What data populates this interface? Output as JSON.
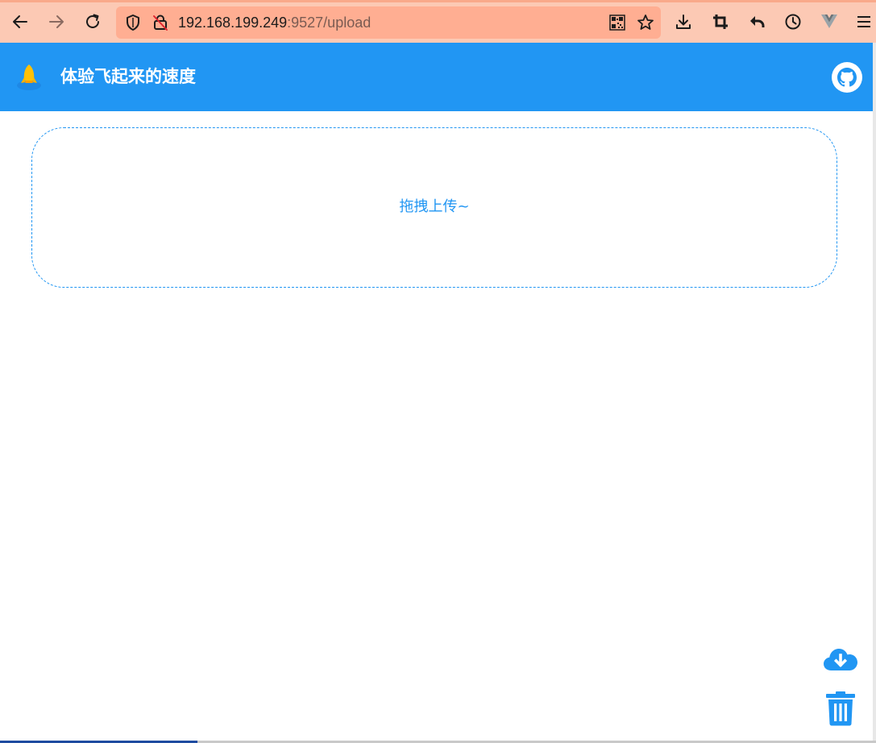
{
  "browser": {
    "url_host": "192.168.199.249",
    "url_rest": ":9527/upload",
    "icons": {
      "back": "arrow-left-icon",
      "forward": "arrow-right-icon",
      "reload": "reload-icon",
      "tracking": "shield-icon",
      "insecure": "lock-insecure-icon",
      "qr": "qr-code-icon",
      "bookmark": "star-icon",
      "downloads": "download-icon",
      "screenshot": "crop-icon",
      "undo": "undo-icon",
      "history": "clock-icon",
      "extension": "vue-devtools-icon",
      "menu": "hamburger-menu-icon"
    },
    "colors": {
      "toolbar": "#fcc9b4",
      "urlbar": "#ffae92"
    }
  },
  "app": {
    "title": "体验飞起来的速度",
    "logo_icon": "rocket-logo-icon",
    "github_icon": "github-icon",
    "header_color": "#2196f3"
  },
  "upload": {
    "hint": "拖拽上传~",
    "accent": "#2196f3"
  },
  "actions": {
    "download_icon": "cloud-download-icon",
    "delete_icon": "trash-icon"
  }
}
